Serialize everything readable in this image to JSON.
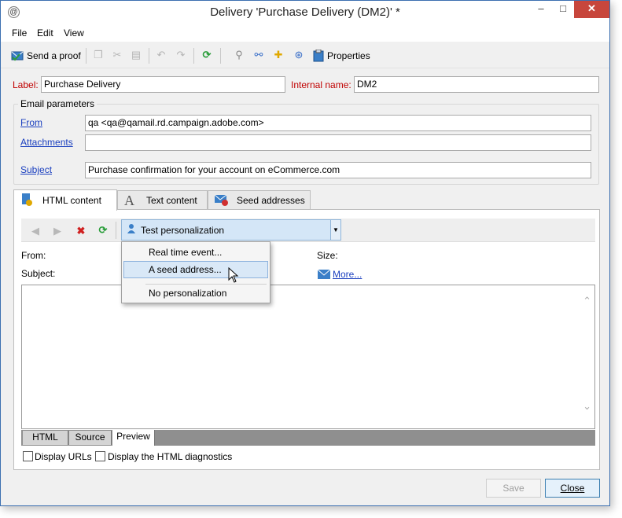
{
  "window": {
    "title": "Delivery 'Purchase Delivery (DM2)' *",
    "controls": {
      "minimize": "–",
      "maximize": "□",
      "close": "✕"
    }
  },
  "menu": [
    "File",
    "Edit",
    "View"
  ],
  "toolbar": {
    "send_proof": "Send a proof",
    "properties": "Properties"
  },
  "form": {
    "label_caption": "Label:",
    "label_value": "Purchase Delivery",
    "internal_name_caption": "Internal name:",
    "internal_name_value": "DM2"
  },
  "email_params": {
    "title": "Email parameters",
    "from_caption": "From",
    "from_value": "qa <qa@qamail.rd.campaign.adobe.com>",
    "attachments_caption": "Attachments",
    "attachments_value": "",
    "subject_caption": "Subject",
    "subject_value": "Purchase confirmation for your account on eCommerce.com"
  },
  "tabs": [
    "HTML content",
    "Text content",
    "Seed addresses"
  ],
  "personalization": {
    "selected": "Test personalization",
    "options": [
      "Real time event...",
      "A seed address...",
      "No personalization"
    ]
  },
  "preview_info": {
    "from_caption": "From:",
    "subject_caption": "Subject:",
    "size_caption": "Size:",
    "more_link": "More..."
  },
  "bottom_tabs": [
    "HTML",
    "Source",
    "Preview"
  ],
  "options": {
    "display_urls": "Display URLs",
    "html_diagnostics": "Display the HTML diagnostics"
  },
  "buttons": {
    "save": "Save",
    "close": "Close"
  },
  "colors": {
    "link": "#1a3fbf",
    "required_label": "#c00000",
    "close_button": "#c7463c",
    "combo_highlight": "#d4e6f7"
  }
}
